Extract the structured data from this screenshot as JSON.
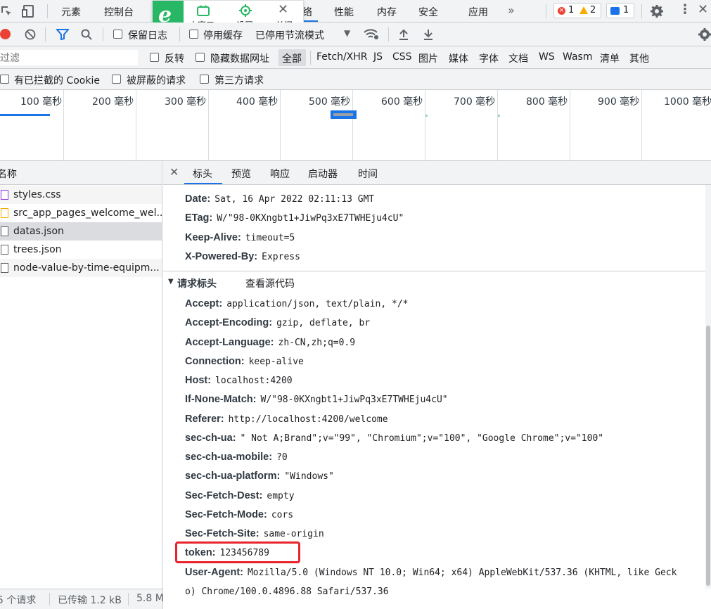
{
  "tabs": [
    "元素",
    "控制台",
    "络",
    "性能",
    "内存",
    "安全",
    "应用"
  ],
  "overlay": {
    "mini_window": "小窗口",
    "settings": "设置",
    "close": "关闭"
  },
  "badges": {
    "errors": "1",
    "warnings": "2",
    "messages": "1"
  },
  "toolbar": {
    "preserve_log": "保留日志",
    "disable_cache": "停用缓存",
    "throttle": "已停用节流模式"
  },
  "filter": {
    "placeholder": "过滤",
    "invert": "反转",
    "hide_data_urls": "隐藏数据网址",
    "types": [
      "全部",
      "Fetch/XHR",
      "JS",
      "CSS",
      "图片",
      "媒体",
      "字体",
      "文档",
      "WS",
      "Wasm",
      "清单",
      "其他"
    ]
  },
  "filter2": {
    "blocked_cookies": "有已拦截的 Cookie",
    "blocked_requests": "被屏蔽的请求",
    "third_party": "第三方请求"
  },
  "timeline": {
    "ticks": [
      "100 毫秒",
      "200 毫秒",
      "300 毫秒",
      "400 毫秒",
      "500 毫秒",
      "600 毫秒",
      "700 毫秒",
      "800 毫秒",
      "900 毫秒",
      "1000 毫秒"
    ]
  },
  "files": {
    "header": "名称",
    "items": [
      "styles.css",
      "src_app_pages_welcome_wel...",
      "datas.json",
      "trees.json",
      "node-value-by-time-equipm..."
    ]
  },
  "detail_tabs": [
    "标头",
    "预览",
    "响应",
    "启动器",
    "时间"
  ],
  "response_headers": [
    {
      "name": "Date:",
      "value": "Sat, 16 Apr 2022 02:11:13 GMT"
    },
    {
      "name": "ETag:",
      "value": "W/\"98-0KXngbt1+JiwPq3xE7TWHEju4cU\""
    },
    {
      "name": "Keep-Alive:",
      "value": "timeout=5"
    },
    {
      "name": "X-Powered-By:",
      "value": "Express"
    }
  ],
  "request_section": {
    "title": "请求标头",
    "view_source": "查看源代码"
  },
  "request_headers": [
    {
      "name": "Accept:",
      "value": "application/json, text/plain, */*"
    },
    {
      "name": "Accept-Encoding:",
      "value": "gzip, deflate, br"
    },
    {
      "name": "Accept-Language:",
      "value": "zh-CN,zh;q=0.9"
    },
    {
      "name": "Connection:",
      "value": "keep-alive"
    },
    {
      "name": "Host:",
      "value": "localhost:4200"
    },
    {
      "name": "If-None-Match:",
      "value": "W/\"98-0KXngbt1+JiwPq3xE7TWHEju4cU\""
    },
    {
      "name": "Referer:",
      "value": "http://localhost:4200/welcome"
    },
    {
      "name": "sec-ch-ua:",
      "value": "\" Not A;Brand\";v=\"99\", \"Chromium\";v=\"100\", \"Google Chrome\";v=\"100\""
    },
    {
      "name": "sec-ch-ua-mobile:",
      "value": "?0"
    },
    {
      "name": "sec-ch-ua-platform:",
      "value": "\"Windows\""
    },
    {
      "name": "Sec-Fetch-Dest:",
      "value": "empty"
    },
    {
      "name": "Sec-Fetch-Mode:",
      "value": "cors"
    },
    {
      "name": "Sec-Fetch-Site:",
      "value": "same-origin"
    },
    {
      "name": "token:",
      "value": "123456789"
    }
  ],
  "user_agent": {
    "name": "User-Agent:",
    "line1": "Mozilla/5.0 (Windows NT 10.0; Win64; x64) AppleWebKit/537.36 (KHTML, like Geck",
    "line2": "o) Chrome/100.0.4896.88 Safari/537.36"
  },
  "status": {
    "requests": "5 个请求",
    "transferred": "已传输 1.2 kB",
    "resources": "5.8 M"
  },
  "colors": {
    "accent": "#1a73e8",
    "highlight": "#e8242c",
    "record": "#ea4335"
  }
}
